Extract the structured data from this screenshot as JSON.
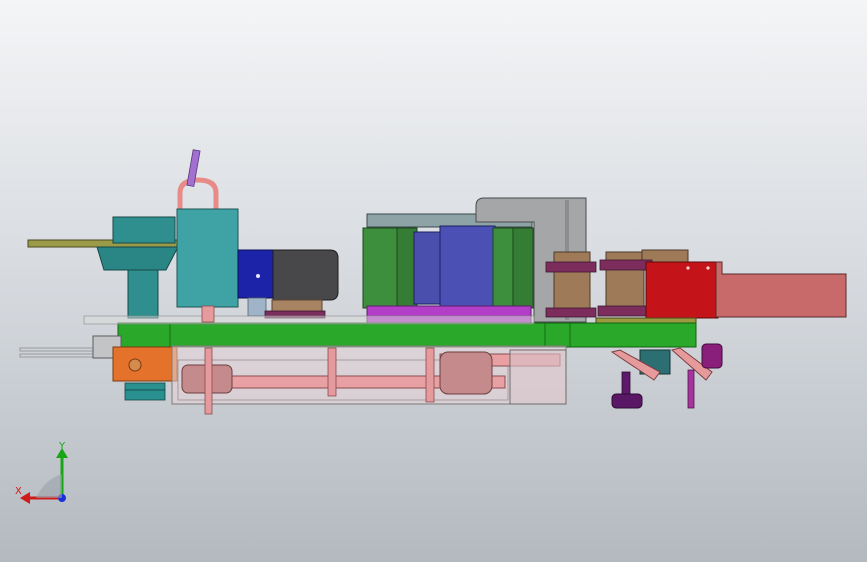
{
  "viewport": {
    "background_top": "#f4f5f7",
    "background_bottom": "#b3b9bf"
  },
  "model": {
    "name": "machine-assembly-side-view"
  },
  "triad": {
    "x_label": "X",
    "y_label": "Y",
    "x_color": "#d11a1a",
    "y_color": "#18a518",
    "z_color": "#1b2fd8"
  }
}
